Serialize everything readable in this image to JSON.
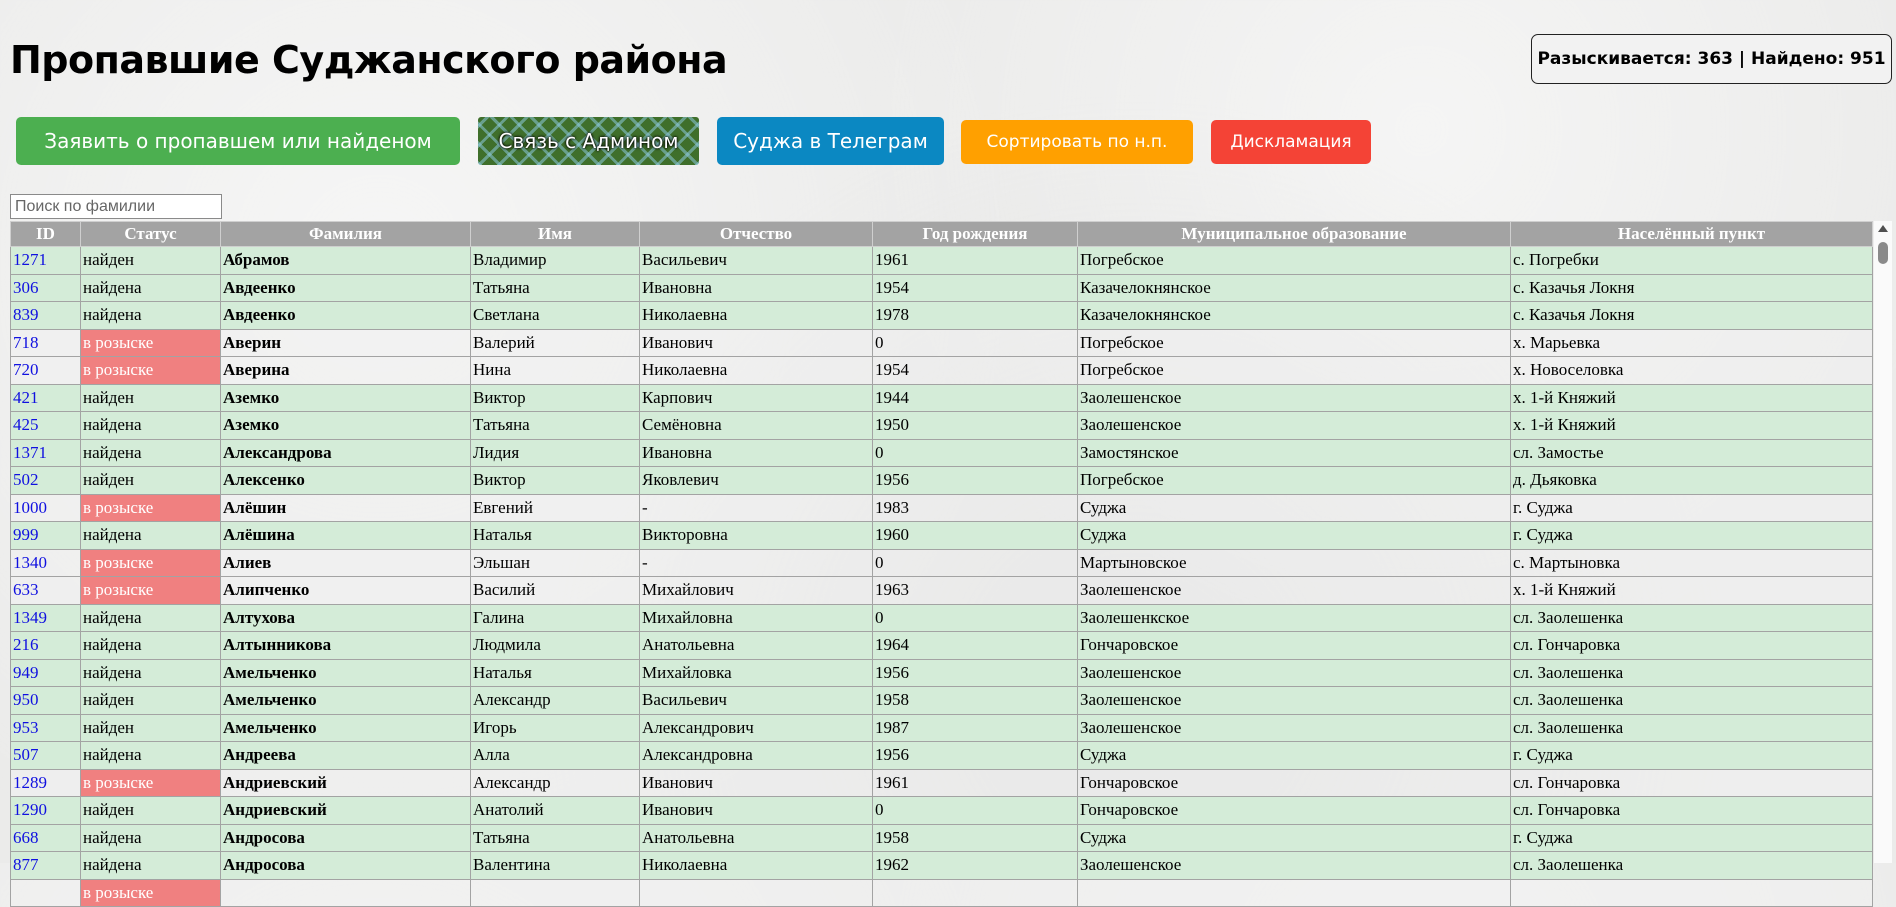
{
  "page": {
    "title": "Пропавшие Суджанского района",
    "counter": "Разыскивается: 363 | Найдено: 951"
  },
  "buttons": {
    "report": "Заявить о пропавшем или найденом",
    "admin": "Связь с Админом",
    "telegram": "Суджа в Телеграм",
    "sort": "Сортировать по н.п.",
    "disclaimer": "Дискламация"
  },
  "colors": {
    "report": "#4caf50",
    "admin": "#3f6f2b",
    "telegram": "#0b88c2",
    "sort": "#ffa000",
    "disclaimer": "#f44336",
    "found_row": "#d4ecd8",
    "wanted_status": "#f08080",
    "header": "#a3a3a3"
  },
  "search": {
    "placeholder": "Поиск по фамилии",
    "value": ""
  },
  "table": {
    "columns": [
      "ID",
      "Статус",
      "Фамилия",
      "Имя",
      "Отчество",
      "Год рождения",
      "Муниципальное образование",
      "Населённый пункт"
    ],
    "rows": [
      {
        "id": "1271",
        "status": "найден",
        "surname": "Абрамов",
        "name": "Владимир",
        "patronymic": "Васильевич",
        "year": "1961",
        "municipality": "Погребское",
        "settlement": "с. Погребки"
      },
      {
        "id": "306",
        "status": "найдена",
        "surname": "Авдеенко",
        "name": "Татьяна",
        "patronymic": "Ивановна",
        "year": "1954",
        "municipality": "Казачелокнянское",
        "settlement": "с. Казачья Локня"
      },
      {
        "id": "839",
        "status": "найдена",
        "surname": "Авдеенко",
        "name": "Светлана",
        "patronymic": "Николаевна",
        "year": "1978",
        "municipality": "Казачелокнянское",
        "settlement": "с. Казачья Локня"
      },
      {
        "id": "718",
        "status": "в розыске",
        "surname": "Аверин",
        "name": "Валерий",
        "patronymic": "Иванович",
        "year": "0",
        "municipality": "Погребское",
        "settlement": "х. Марьевка"
      },
      {
        "id": "720",
        "status": "в розыске",
        "surname": "Аверина",
        "name": "Нина",
        "patronymic": "Николаевна",
        "year": "1954",
        "municipality": "Погребское",
        "settlement": "х. Новоселовка"
      },
      {
        "id": "421",
        "status": "найден",
        "surname": "Аземко",
        "name": "Виктор",
        "patronymic": "Карпович",
        "year": "1944",
        "municipality": "Заолешенское",
        "settlement": "х. 1-й Княжий"
      },
      {
        "id": "425",
        "status": "найдена",
        "surname": "Аземко",
        "name": "Татьяна",
        "patronymic": "Семёновна",
        "year": "1950",
        "municipality": "Заолешенское",
        "settlement": "х. 1-й Княжий"
      },
      {
        "id": "1371",
        "status": "найдена",
        "surname": "Александрова",
        "name": "Лидия",
        "patronymic": "Ивановна",
        "year": "0",
        "municipality": "Замостянское",
        "settlement": "сл. Замостье"
      },
      {
        "id": "502",
        "status": "найден",
        "surname": "Алексенко",
        "name": "Виктор",
        "patronymic": "Яковлевич",
        "year": "1956",
        "municipality": "Погребское",
        "settlement": "д. Дьяковка"
      },
      {
        "id": "1000",
        "status": "в розыске",
        "surname": "Алёшин",
        "name": "Евгений",
        "patronymic": "-",
        "year": "1983",
        "municipality": "Суджа",
        "settlement": "г. Суджа"
      },
      {
        "id": "999",
        "status": "найдена",
        "surname": "Алёшина",
        "name": "Наталья",
        "patronymic": "Викторовна",
        "year": "1960",
        "municipality": "Суджа",
        "settlement": "г. Суджа"
      },
      {
        "id": "1340",
        "status": "в розыске",
        "surname": "Алиев",
        "name": "Эльшан",
        "patronymic": "-",
        "year": "0",
        "municipality": "Мартыновское",
        "settlement": "с. Мартыновка"
      },
      {
        "id": "633",
        "status": "в розыске",
        "surname": "Алипченко",
        "name": "Василий",
        "patronymic": "Михайлович",
        "year": "1963",
        "municipality": "Заолешенское",
        "settlement": "х. 1-й Княжий"
      },
      {
        "id": "1349",
        "status": "найдена",
        "surname": "Алтухова",
        "name": "Галина",
        "patronymic": "Михайловна",
        "year": "0",
        "municipality": "Заолешенкское",
        "settlement": "сл. Заолешенка"
      },
      {
        "id": "216",
        "status": "найдена",
        "surname": "Алтынникова",
        "name": "Людмила",
        "patronymic": "Анатольевна",
        "year": "1964",
        "municipality": "Гончаровское",
        "settlement": "сл. Гончаровка"
      },
      {
        "id": "949",
        "status": "найдена",
        "surname": "Амельченко",
        "name": "Наталья",
        "patronymic": "Михайловка",
        "year": "1956",
        "municipality": "Заолешенское",
        "settlement": "сл. Заолешенка"
      },
      {
        "id": "950",
        "status": "найден",
        "surname": "Амельченко",
        "name": "Александр",
        "patronymic": "Васильевич",
        "year": "1958",
        "municipality": "Заолешенское",
        "settlement": "сл. Заолешенка"
      },
      {
        "id": "953",
        "status": "найден",
        "surname": "Амельченко",
        "name": "Игорь",
        "patronymic": "Александрович",
        "year": "1987",
        "municipality": "Заолешенское",
        "settlement": "сл. Заолешенка"
      },
      {
        "id": "507",
        "status": "найдена",
        "surname": "Андреева",
        "name": "Алла",
        "patronymic": "Александровна",
        "year": "1956",
        "municipality": "Суджа",
        "settlement": "г. Суджа"
      },
      {
        "id": "1289",
        "status": "в розыске",
        "surname": "Андриевский",
        "name": "Александр",
        "patronymic": "Иванович",
        "year": "1961",
        "municipality": "Гончаровское",
        "settlement": "сл. Гончаровка"
      },
      {
        "id": "1290",
        "status": "найден",
        "surname": "Андриевский",
        "name": "Анатолий",
        "patronymic": "Иванович",
        "year": "0",
        "municipality": "Гончаровское",
        "settlement": "сл. Гончаровка"
      },
      {
        "id": "668",
        "status": "найдена",
        "surname": "Андросова",
        "name": "Татьяна",
        "patronymic": "Анатольевна",
        "year": "1958",
        "municipality": "Суджа",
        "settlement": "г. Суджа"
      },
      {
        "id": "877",
        "status": "найдена",
        "surname": "Андросова",
        "name": "Валентина",
        "patronymic": "Николаевна",
        "year": "1962",
        "municipality": "Заолешенское",
        "settlement": "сл. Заолешенка"
      },
      {
        "id": "",
        "status": "в розыске",
        "surname": "",
        "name": "",
        "patronymic": "",
        "year": "",
        "municipality": "",
        "settlement": ""
      }
    ]
  }
}
